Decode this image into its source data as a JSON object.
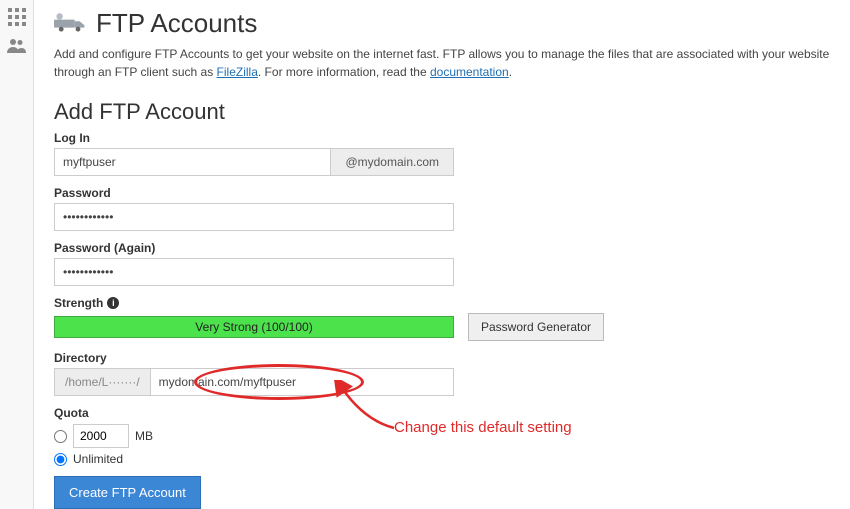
{
  "sidebar": {
    "icons": [
      "grid-icon",
      "users-icon"
    ]
  },
  "header": {
    "icon": "truck-icon",
    "title": "FTP Accounts"
  },
  "description": {
    "before": "Add and configure FTP Accounts to get your website on the internet fast. FTP allows you to manage the files that are associated with your website through an FTP client such as ",
    "link1_text": "FileZilla",
    "mid": ". For more information, read the ",
    "link2_text": "documentation",
    "after": "."
  },
  "form": {
    "heading": "Add FTP Account",
    "login": {
      "label": "Log In",
      "value": "myftpuser",
      "domain_suffix": "@mydomain.com"
    },
    "password": {
      "label": "Password",
      "value": "••••••••••••"
    },
    "password_again": {
      "label": "Password (Again)",
      "value": "••••••••••••"
    },
    "strength": {
      "label": "Strength",
      "meter_text": "Very Strong (100/100)",
      "generator_btn": "Password Generator"
    },
    "directory": {
      "label": "Directory",
      "prefix": "/home/L·······/",
      "value": "mydomain.com/myftpuser"
    },
    "quota": {
      "label": "Quota",
      "size_value": "2000",
      "size_unit": "MB",
      "unlimited_label": "Unlimited",
      "selected": "unlimited"
    },
    "submit": "Create FTP Account"
  },
  "annotation": {
    "text": "Change this default setting"
  }
}
